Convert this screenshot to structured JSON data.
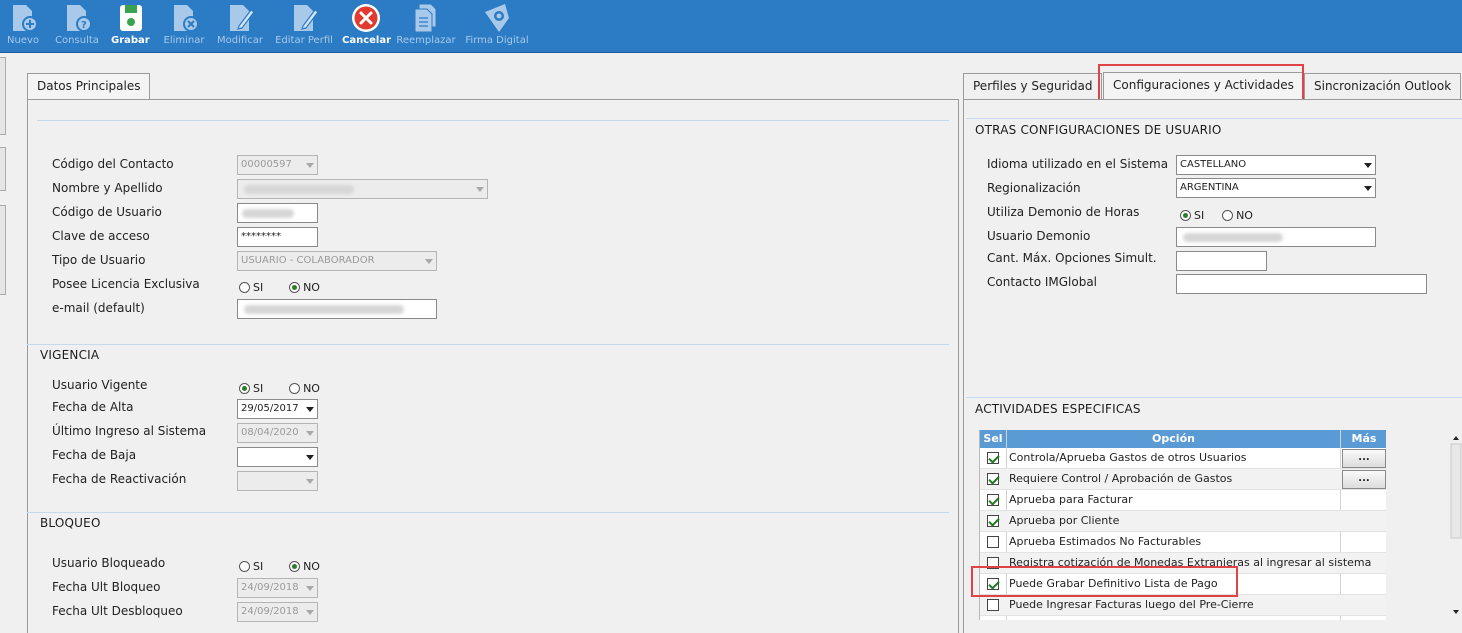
{
  "toolbar": {
    "buttons": [
      {
        "label": "Nuevo",
        "icon": "new-doc-icon"
      },
      {
        "label": "Consulta",
        "icon": "query-doc-icon"
      },
      {
        "label": "Grabar",
        "icon": "save-disk-icon"
      },
      {
        "label": "Eliminar",
        "icon": "delete-doc-icon"
      },
      {
        "label": "Modificar",
        "icon": "edit-pencil-icon"
      },
      {
        "label": "Editar Perfil",
        "icon": "edit-profile-icon"
      },
      {
        "label": "Cancelar",
        "icon": "cancel-x-icon"
      },
      {
        "label": "Reemplazar",
        "icon": "replace-docs-icon"
      },
      {
        "label": "Firma Digital",
        "icon": "digital-signature-icon"
      }
    ],
    "active_labels": [
      "Grabar",
      "Cancelar"
    ]
  },
  "left_panel": {
    "tab_label": "Datos Principales",
    "fields": {
      "codigo_contacto": {
        "label": "Código del Contacto",
        "value": "00000597"
      },
      "nombre_apellido": {
        "label": "Nombre y Apellido",
        "value": ""
      },
      "codigo_usuario": {
        "label": "Código de Usuario",
        "value": ""
      },
      "clave_acceso": {
        "label": "Clave de acceso",
        "value": "********"
      },
      "tipo_usuario": {
        "label": "Tipo de Usuario",
        "value": "USUARIO - COLABORADOR"
      },
      "licencia_exclusiva": {
        "label": "Posee Licencia Exclusiva",
        "options": [
          "SI",
          "NO"
        ],
        "selected": "NO"
      },
      "email": {
        "label": "e-mail (default)",
        "value": ""
      }
    },
    "vigencia": {
      "title": "VIGENCIA",
      "usuario_vigente": {
        "label": "Usuario Vigente",
        "options": [
          "SI",
          "NO"
        ],
        "selected": "SI"
      },
      "fecha_alta": {
        "label": "Fecha de Alta",
        "value": "29/05/2017"
      },
      "ultimo_ingreso": {
        "label": "Último Ingreso al Sistema",
        "value": "08/04/2020"
      },
      "fecha_baja": {
        "label": "Fecha de Baja",
        "value": "  /  /"
      },
      "fecha_reactivacion": {
        "label": "Fecha de Reactivación",
        "value": "  /  /"
      }
    },
    "bloqueo": {
      "title": "BLOQUEO",
      "usuario_bloqueado": {
        "label": "Usuario Bloqueado",
        "options": [
          "SI",
          "NO"
        ],
        "selected": "NO"
      },
      "fecha_ult_bloqueo": {
        "label": "Fecha Ult Bloqueo",
        "value": "24/09/2018"
      },
      "fecha_ult_desbloqueo": {
        "label": "Fecha Ult Desbloqueo",
        "value": "24/09/2018"
      }
    }
  },
  "right_panel": {
    "tabs": [
      "Perfiles y Seguridad",
      "Configuraciones y Actividades",
      "Sincronización Outlook"
    ],
    "selected_tab": "Configuraciones y Actividades",
    "otras_config": {
      "title": "OTRAS CONFIGURACIONES DE USUARIO",
      "idioma": {
        "label": "Idioma utilizado en el Sistema",
        "value": "CASTELLANO"
      },
      "regionalizacion": {
        "label": "Regionalización",
        "value": "ARGENTINA"
      },
      "demonio_horas": {
        "label": "Utiliza Demonio de Horas",
        "options": [
          "SI",
          "NO"
        ],
        "selected": "SI"
      },
      "usuario_demonio": {
        "label": "Usuario Demonio",
        "value": ""
      },
      "cant_max_opciones": {
        "label": "Cant. Máx. Opciones Simult.",
        "value": ""
      },
      "contacto_imglobal": {
        "label": "Contacto IMGlobal",
        "value": ""
      }
    },
    "actividades": {
      "title": "ACTIVIDADES ESPECIFICAS",
      "columns": [
        "Sel",
        "Opción",
        "Más"
      ],
      "more_button_label": "...",
      "rows": [
        {
          "option": "Controla/Aprueba Gastos de otros Usuarios",
          "checked": true,
          "has_more": true
        },
        {
          "option": "Requiere Control / Aprobación de Gastos",
          "checked": true,
          "has_more": true
        },
        {
          "option": "Aprueba para Facturar",
          "checked": true,
          "has_more": false
        },
        {
          "option": "Aprueba por Cliente",
          "checked": true,
          "has_more": false
        },
        {
          "option": "Aprueba Estimados No Facturables",
          "checked": false,
          "has_more": false
        },
        {
          "option": "Registra cotización de Monedas Extranjeras al ingresar al sistema",
          "checked": false,
          "has_more": false
        },
        {
          "option": "Puede Grabar Definitivo Lista de Pago",
          "checked": true,
          "has_more": false
        },
        {
          "option": "Puede Ingresar Facturas luego del Pre-Cierre",
          "checked": false,
          "has_more": false
        }
      ]
    }
  },
  "colors": {
    "toolbar_bg": "#2b7bc5",
    "grid_header": "#5b9bd5",
    "highlight": "#e04343",
    "check_green": "#1f7a1f"
  }
}
